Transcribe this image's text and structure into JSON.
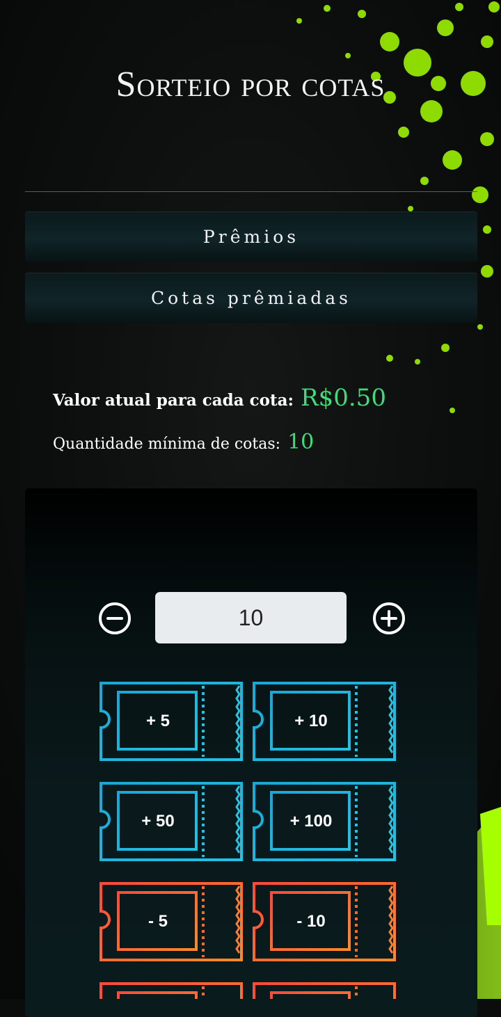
{
  "header": {
    "title": "Sorteio por cotas"
  },
  "accordion": [
    {
      "label": "Prêmios"
    },
    {
      "label": "Cotas prêmiadas"
    }
  ],
  "info": {
    "price_label": "Valor atual para cada cota:",
    "price_value": "R$0.50",
    "min_label": "Quantidade mínima de cotas:",
    "min_value": "10"
  },
  "stepper": {
    "value": "10"
  },
  "tickets": {
    "row1": [
      "+ 5",
      "+ 10"
    ],
    "row2": [
      "+ 50",
      "+ 100"
    ],
    "row3": [
      "- 5",
      "- 10"
    ]
  },
  "colors": {
    "accent_green": "#3fdc7a",
    "ticket_blue": "#1fb6d8",
    "ticket_red": "#ff5a3a",
    "splatter": "#a6ff00"
  }
}
